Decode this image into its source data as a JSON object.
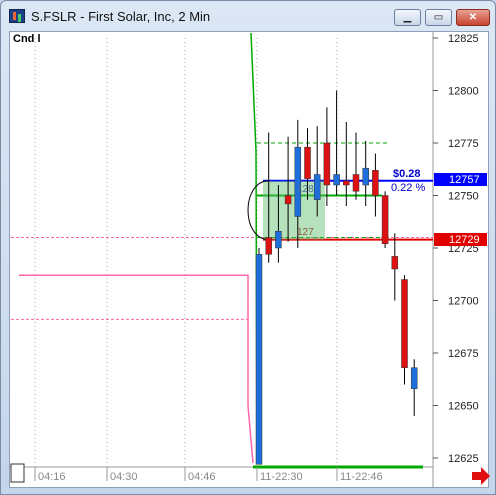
{
  "window": {
    "title": "S.FSLR - First Solar, Inc, 2 Min",
    "minimize_icon": "minimize-icon",
    "maximize_icon": "maximize-icon",
    "close_icon": "close-icon"
  },
  "indicator_label": "Cnd l",
  "price_axis": {
    "ticks": [
      "12825",
      "12800",
      "12775",
      "12750",
      "12725",
      "12700",
      "12675",
      "12650",
      "12625"
    ],
    "tick_values": [
      12825,
      12800,
      12775,
      12750,
      12725,
      12700,
      12675,
      12650,
      12625
    ]
  },
  "time_axis": {
    "ticks": [
      "04:16",
      "04:30",
      "04:46",
      "11-22:30",
      "11-22:46"
    ]
  },
  "price_labels": {
    "blue_line": "12757",
    "red_line": "12729",
    "blue_color": "#0000ff",
    "red_color": "#e00000"
  },
  "annotations": {
    "change_amount": "$0.28",
    "change_percent": "0.22 %",
    "bar_count_upper": "128",
    "bar_count_lower": "127"
  },
  "colors": {
    "up_candle": "#1e6fd9",
    "down_candle": "#dd1111",
    "green_line": "#00aa00",
    "pink_line": "#ff66aa"
  },
  "chart_data": {
    "type": "candlestick",
    "ylim": [
      12618,
      12832
    ],
    "levels": {
      "blue": 12757,
      "red": 12729,
      "green_solid": 12750,
      "green_dashed_upper": 12775,
      "green_dashed_lower": 12730,
      "pink_dashed": 12730,
      "pink_solid": 12712,
      "pink_dashed_lower": 12691
    },
    "candles": [
      {
        "open": 12622,
        "high": 12725,
        "low": 12622,
        "close": 12722
      },
      {
        "open": 12730,
        "high": 12780,
        "low": 12718,
        "close": 12722
      },
      {
        "open": 12725,
        "high": 12755,
        "low": 12718,
        "close": 12733
      },
      {
        "open": 12750,
        "high": 12778,
        "low": 12728,
        "close": 12746
      },
      {
        "open": 12740,
        "high": 12786,
        "low": 12725,
        "close": 12773
      },
      {
        "open": 12773,
        "high": 12782,
        "low": 12748,
        "close": 12758
      },
      {
        "open": 12748,
        "high": 12783,
        "low": 12740,
        "close": 12760
      },
      {
        "open": 12775,
        "high": 12792,
        "low": 12745,
        "close": 12755
      },
      {
        "open": 12755,
        "high": 12800,
        "low": 12750,
        "close": 12760
      },
      {
        "open": 12757,
        "high": 12785,
        "low": 12745,
        "close": 12755
      },
      {
        "open": 12760,
        "high": 12780,
        "low": 12748,
        "close": 12752
      },
      {
        "open": 12755,
        "high": 12776,
        "low": 12745,
        "close": 12763
      },
      {
        "open": 12762,
        "high": 12770,
        "low": 12740,
        "close": 12750
      },
      {
        "open": 12750,
        "high": 12752,
        "low": 12725,
        "close": 12727
      },
      {
        "open": 12721,
        "high": 12732,
        "low": 12700,
        "close": 12715
      },
      {
        "open": 12710,
        "high": 12712,
        "low": 12660,
        "close": 12668
      },
      {
        "open": 12658,
        "high": 12672,
        "low": 12645,
        "close": 12668
      }
    ]
  }
}
